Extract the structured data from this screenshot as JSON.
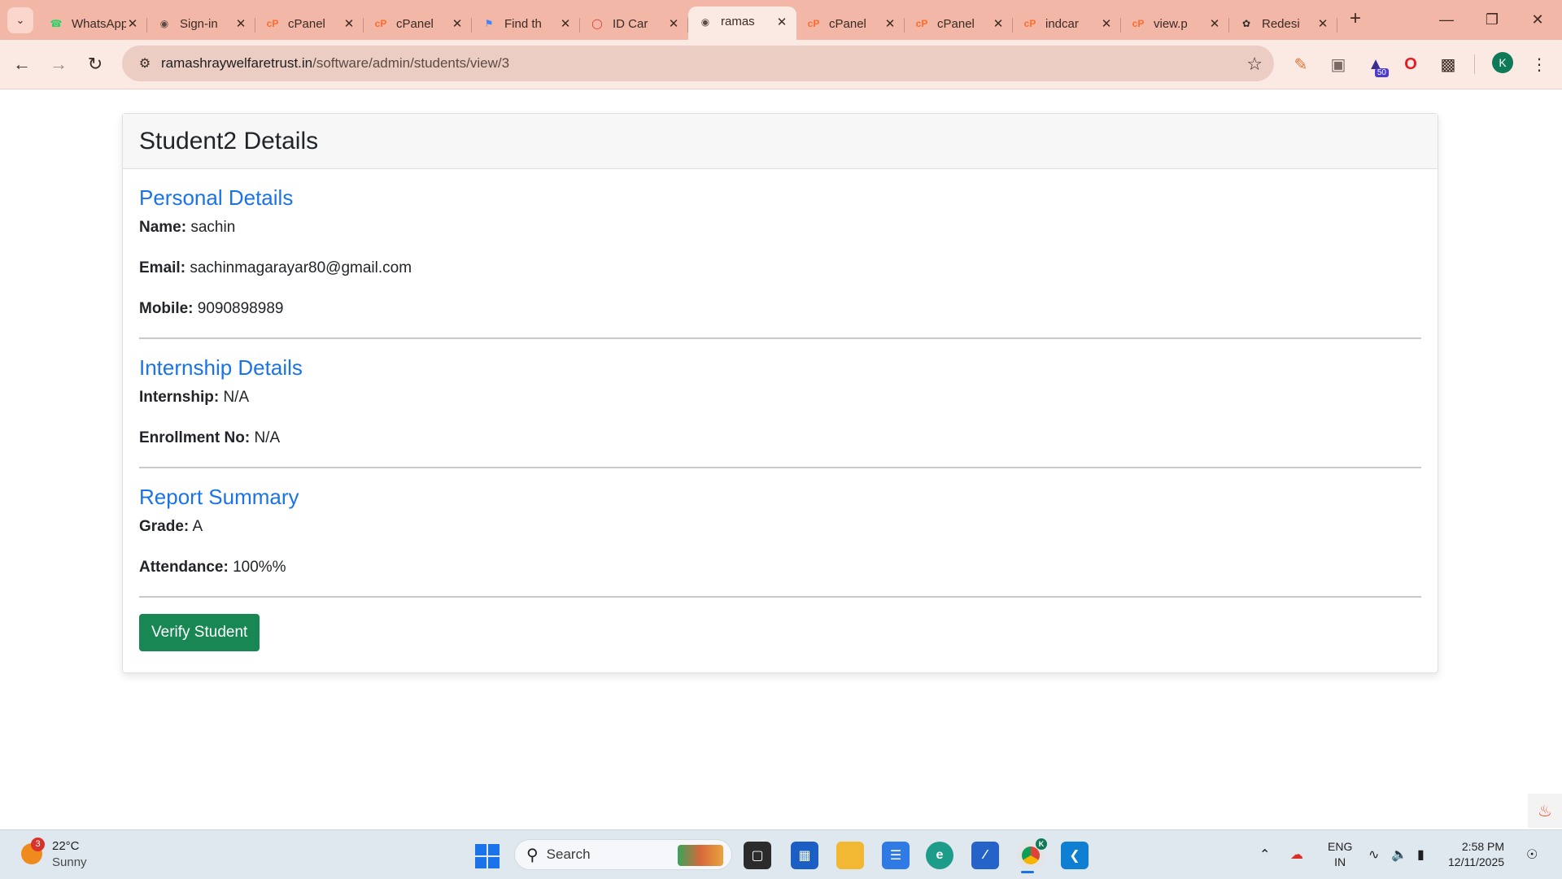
{
  "browser": {
    "tabs": [
      {
        "title": "WhatsApp",
        "icon": "whatsapp-icon",
        "active": false
      },
      {
        "title": "Sign-in",
        "icon": "globe-icon",
        "active": false
      },
      {
        "title": "cPanel",
        "icon": "cpanel-icon",
        "active": false
      },
      {
        "title": "cPanel",
        "icon": "cpanel-icon",
        "active": false
      },
      {
        "title": "Find th",
        "icon": "flag-icon",
        "active": false
      },
      {
        "title": "ID Car",
        "icon": "id-card-icon",
        "active": false
      },
      {
        "title": "ramas",
        "icon": "globe-icon",
        "active": true
      },
      {
        "title": "cPanel",
        "icon": "cpanel-icon",
        "active": false
      },
      {
        "title": "cPanel",
        "icon": "cpanel-icon",
        "active": false
      },
      {
        "title": "indcar",
        "icon": "cpanel-icon",
        "active": false
      },
      {
        "title": "view.p",
        "icon": "cpanel-icon",
        "active": false
      },
      {
        "title": "Redesi",
        "icon": "openai-icon",
        "active": false
      }
    ],
    "url_domain": "ramashraywelfaretrust.in",
    "url_path": "/software/admin/students/view/3",
    "profile_initial": "K",
    "extension_badge": "50"
  },
  "page": {
    "title": "Student2 Details",
    "personal": {
      "heading": "Personal Details",
      "name_label": "Name:",
      "name_value": "sachin",
      "email_label": "Email:",
      "email_value": "sachinmagarayar80@gmail.com",
      "mobile_label": "Mobile:",
      "mobile_value": "9090898989"
    },
    "internship": {
      "heading": "Internship Details",
      "internship_label": "Internship:",
      "internship_value": "N/A",
      "enrollment_label": "Enrollment No:",
      "enrollment_value": "N/A"
    },
    "report": {
      "heading": "Report Summary",
      "grade_label": "Grade:",
      "grade_value": "A",
      "attendance_label": "Attendance:",
      "attendance_value": "100%%"
    },
    "verify_button": "Verify Student"
  },
  "taskbar": {
    "weather_badge": "3",
    "temperature": "22°C",
    "condition": "Sunny",
    "search_placeholder": "Search",
    "lang_line1": "ENG",
    "lang_line2": "IN",
    "time": "2:58 PM",
    "date": "12/11/2025",
    "chrome_profile_initial": "K"
  },
  "colors": {
    "tab_strip": "#f2b7a6",
    "toolbar": "#fbe9e4",
    "section_heading": "#1a73e8",
    "verify_button": "#198754"
  }
}
